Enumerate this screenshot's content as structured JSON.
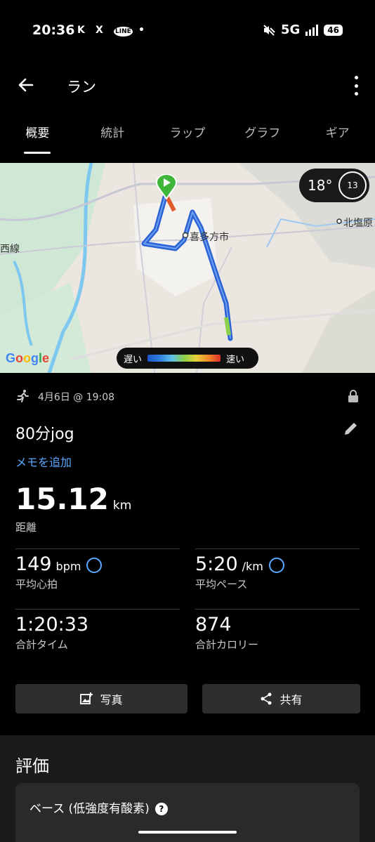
{
  "status_bar": {
    "time": "20:36",
    "notif_icons": [
      "K",
      "X",
      "LINE",
      "•"
    ],
    "network": "5G",
    "battery": "46"
  },
  "app_bar": {
    "title": "ラン"
  },
  "tabs": [
    {
      "label": "概要",
      "active": true
    },
    {
      "label": "統計",
      "active": false
    },
    {
      "label": "ラップ",
      "active": false
    },
    {
      "label": "グラフ",
      "active": false
    },
    {
      "label": "ギア",
      "active": false
    }
  ],
  "map": {
    "temperature": "18°",
    "wind": "13",
    "labels": {
      "city": "喜多方市",
      "north": "北塩原",
      "line": "西線"
    },
    "attribution": "Google",
    "legend_slow": "遅い",
    "legend_fast": "速い"
  },
  "activity": {
    "date": "4月6日 @ 19:08",
    "name": "80分jog",
    "add_memo": "メモを追加",
    "distance": {
      "value": "15.12",
      "unit": "km",
      "label": "距離"
    },
    "metrics": {
      "heart_rate": {
        "value": "149",
        "unit": "bpm",
        "label": "平均心拍"
      },
      "pace": {
        "value": "5:20",
        "unit": "/km",
        "label": "平均ペース"
      },
      "time": {
        "value": "1:20:33",
        "label": "合計タイム"
      },
      "calories": {
        "value": "874",
        "label": "合計カロリー"
      }
    }
  },
  "buttons": {
    "photo": "写真",
    "share": "共有"
  },
  "evaluation": {
    "heading": "評価",
    "card_title": "ベース (低強度有酸素)"
  },
  "colors": {
    "accent": "#5aa8ff",
    "route": "#2b63d6",
    "start_marker": "#3fb63a"
  }
}
